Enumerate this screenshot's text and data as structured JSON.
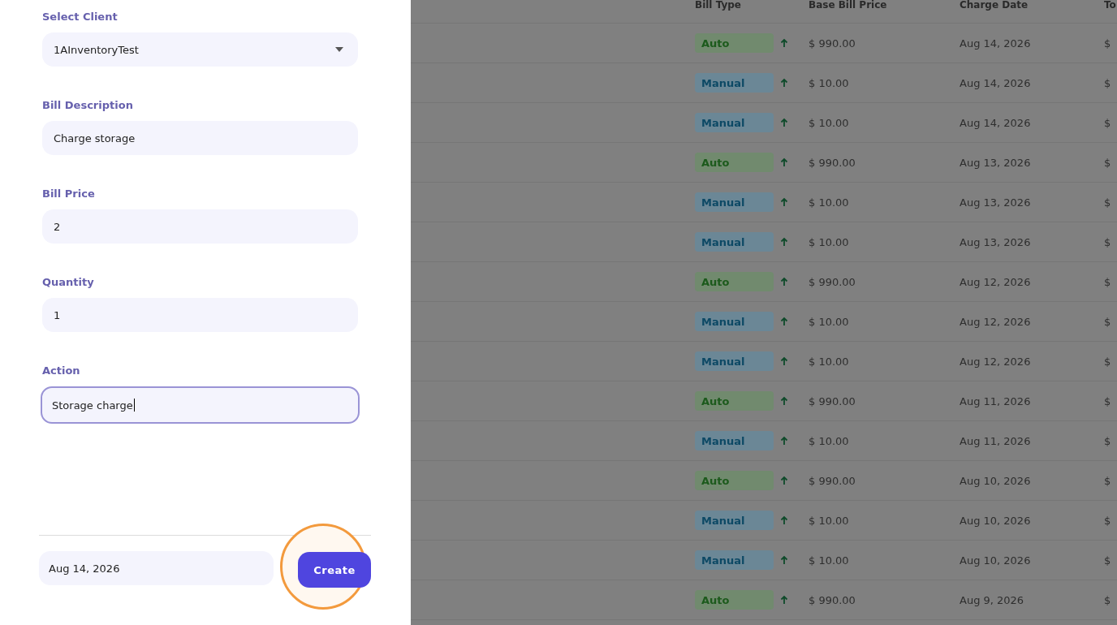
{
  "form": {
    "fields": [
      {
        "label": "Select Client",
        "kind": "select",
        "value": "1AInventoryTest",
        "focused": false
      },
      {
        "label": "Bill Description",
        "kind": "text",
        "value": "Charge storage",
        "focused": false
      },
      {
        "label": "Bill Price",
        "kind": "text",
        "value": "2",
        "focused": false
      },
      {
        "label": "Quantity",
        "kind": "text",
        "value": "1",
        "focused": false
      },
      {
        "label": "Action",
        "kind": "text",
        "value": "Storage charge",
        "focused": true
      }
    ],
    "date": "Aug 14, 2026",
    "submit": "Create",
    "highlighted": true
  },
  "table": {
    "columns": [
      "Bill Type",
      "Base Bill Price",
      "Charge Date",
      "To"
    ],
    "rows": [
      {
        "bill_type": "Auto",
        "kind": "auto",
        "price": "$ 990.00",
        "date": "Aug 14, 2026",
        "column_4": "$"
      },
      {
        "bill_type": "Manual",
        "kind": "manual",
        "price": "$ 10.00",
        "date": "Aug 14, 2026",
        "column_4": "$"
      },
      {
        "bill_type": "Manual",
        "kind": "manual",
        "price": "$ 10.00",
        "date": "Aug 14, 2026",
        "column_4": "$"
      },
      {
        "bill_type": "Auto",
        "kind": "auto",
        "price": "$ 990.00",
        "date": "Aug 13, 2026",
        "column_4": "$"
      },
      {
        "bill_type": "Manual",
        "kind": "manual",
        "price": "$ 10.00",
        "date": "Aug 13, 2026",
        "column_4": "$"
      },
      {
        "bill_type": "Manual",
        "kind": "manual",
        "price": "$ 10.00",
        "date": "Aug 13, 2026",
        "column_4": "$"
      },
      {
        "bill_type": "Auto",
        "kind": "auto",
        "price": "$ 990.00",
        "date": "Aug 12, 2026",
        "column_4": "$"
      },
      {
        "bill_type": "Manual",
        "kind": "manual",
        "price": "$ 10.00",
        "date": "Aug 12, 2026",
        "column_4": "$"
      },
      {
        "bill_type": "Manual",
        "kind": "manual",
        "price": "$ 10.00",
        "date": "Aug 12, 2026",
        "column_4": "$"
      },
      {
        "bill_type": "Auto",
        "kind": "auto",
        "price": "$ 990.00",
        "date": "Aug 11, 2026",
        "column_4": "$"
      },
      {
        "bill_type": "Manual",
        "kind": "manual",
        "price": "$ 10.00",
        "date": "Aug 11, 2026",
        "column_4": "$"
      },
      {
        "bill_type": "Auto",
        "kind": "auto",
        "price": "$ 990.00",
        "date": "Aug 10, 2026",
        "column_4": "$"
      },
      {
        "bill_type": "Manual",
        "kind": "manual",
        "price": "$ 10.00",
        "date": "Aug 10, 2026",
        "column_4": "$"
      },
      {
        "bill_type": "Manual",
        "kind": "manual",
        "price": "$ 10.00",
        "date": "Aug 10, 2026",
        "column_4": "$"
      },
      {
        "bill_type": "Auto",
        "kind": "auto",
        "price": "$ 990.00",
        "date": "Aug 9, 2026",
        "column_4": "$"
      }
    ]
  }
}
